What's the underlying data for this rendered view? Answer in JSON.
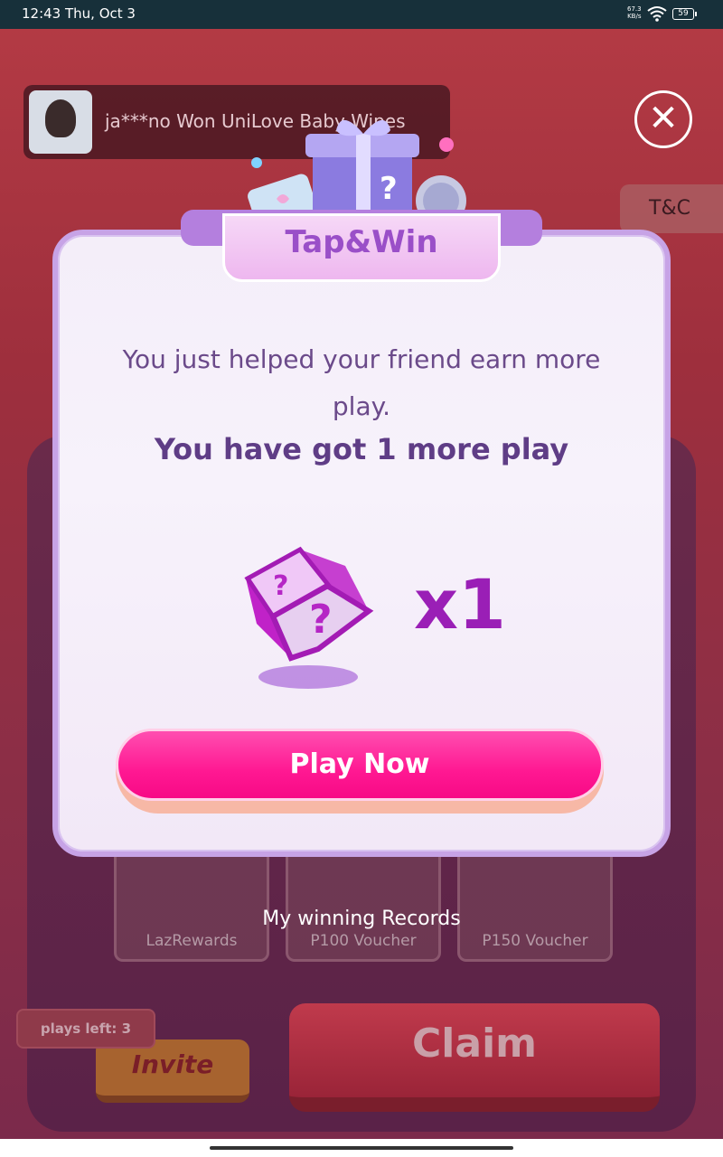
{
  "status_bar": {
    "time": "12:43",
    "date": "Thu, Oct 3",
    "net_speed_value": "67.3",
    "net_speed_unit": "KB/s",
    "battery": "59"
  },
  "background": {
    "ticker_text": "ja***no Won UniLove Baby Wipes",
    "tc_label": "T&C",
    "prizes": [
      "LazRewards",
      "P100 Voucher",
      "P150 Voucher"
    ],
    "records_label": "My winning Records",
    "plays_left": "plays left: 3",
    "invite_label": "Invite",
    "claim_label": "Claim"
  },
  "modal": {
    "title": "Tap&Win",
    "message": "You just helped your friend earn more play.",
    "highlight": "You have got 1 more play",
    "reward_quantity": "x1",
    "play_button": "Play Now",
    "close_icon": "close-icon"
  },
  "colors": {
    "accent": "#ff1892",
    "title": "#9a4fc8",
    "text": "#6b4a8a",
    "quantity": "#9a1fb6"
  }
}
